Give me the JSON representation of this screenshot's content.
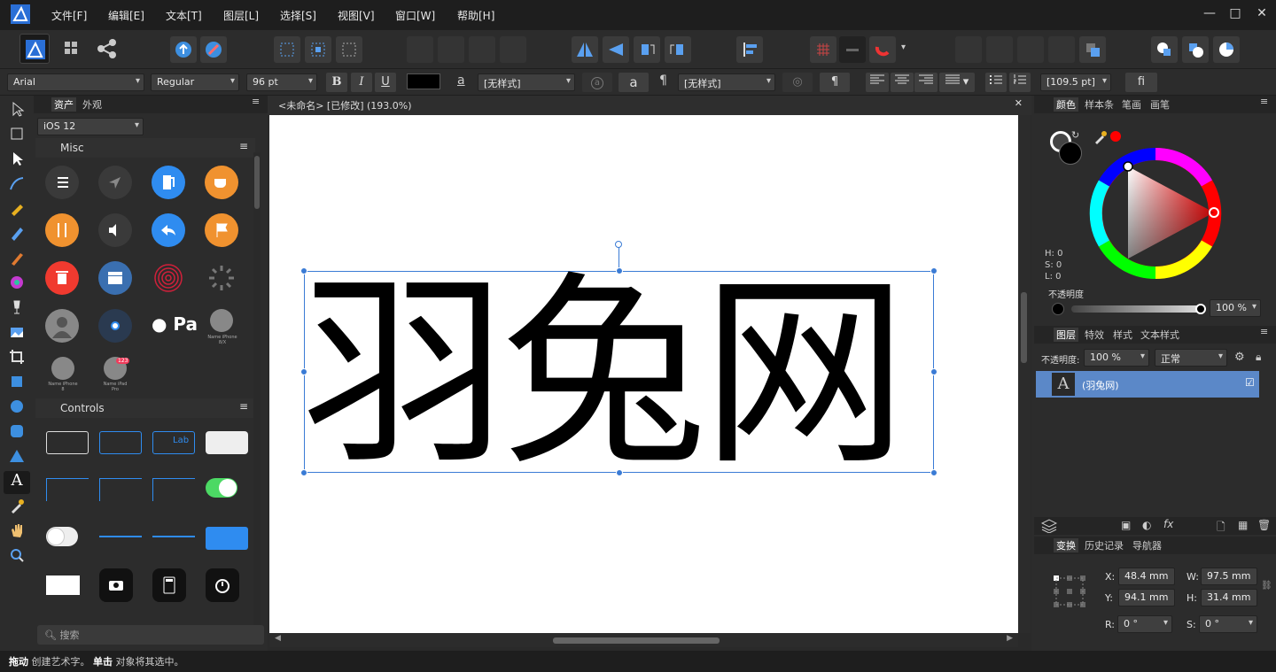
{
  "menu": [
    "文件[F]",
    "编辑[E]",
    "文本[T]",
    "图层[L]",
    "选择[S]",
    "视图[V]",
    "窗口[W]",
    "帮助[H]"
  ],
  "window_controls": {
    "minimize": "—",
    "maximize": "□",
    "close": "✕"
  },
  "context": {
    "font_family": "Arial",
    "font_style": "Regular",
    "font_size": "96 pt",
    "bold": "B",
    "italic": "I",
    "underline": "U",
    "char_style_icon": "a",
    "char_style": "[无样式]",
    "char_a": "a",
    "pilcrow": "¶",
    "para_style": "[无样式]",
    "leading": "[109.5 pt]",
    "ligature": "fi"
  },
  "left_panel": {
    "tabs": [
      "资产",
      "外观"
    ],
    "category": "iOS 12",
    "misc_title": "Misc",
    "controls_title": "Controls",
    "search_placeholder": "搜索",
    "name_labels": [
      "Name iPhone 8/X",
      "Name iPhone 8",
      "Name iPad Pro"
    ],
    "badge": "123",
    "apple_pay": "Pa",
    "label_text": "Lab"
  },
  "document": {
    "title": "<未命名> [已修改] (193.0%)",
    "text": "羽兔网"
  },
  "color_panel": {
    "tabs": [
      "颜色",
      "样本条",
      "笔画",
      "画笔"
    ],
    "h": "H: 0",
    "s": "S: 0",
    "l": "L: 0",
    "opacity_label": "不透明度",
    "opacity_value": "100 %",
    "accent": "#ff0000"
  },
  "layers_panel": {
    "tabs": [
      "图层",
      "特效",
      "样式",
      "文本样式"
    ],
    "opacity_label": "不透明度:",
    "opacity_value": "100 %",
    "blend": "正常",
    "layer_name": "(羽兔网)",
    "layer_icon": "A",
    "fx": "fx"
  },
  "transform_panel": {
    "tabs": [
      "变换",
      "历史记录",
      "导航器"
    ],
    "x_label": "X:",
    "x": "48.4 mm",
    "w_label": "W:",
    "w": "97.5 mm",
    "y_label": "Y:",
    "y": "94.1 mm",
    "h_label": "H:",
    "h": "31.4 mm",
    "r_label": "R:",
    "r": "0 °",
    "s_label": "S:",
    "s": "0 °"
  },
  "status": {
    "b1": "拖动",
    "t1": " 创建艺术字。",
    "b2": "单击",
    "t2": " 对象将其选中。"
  }
}
